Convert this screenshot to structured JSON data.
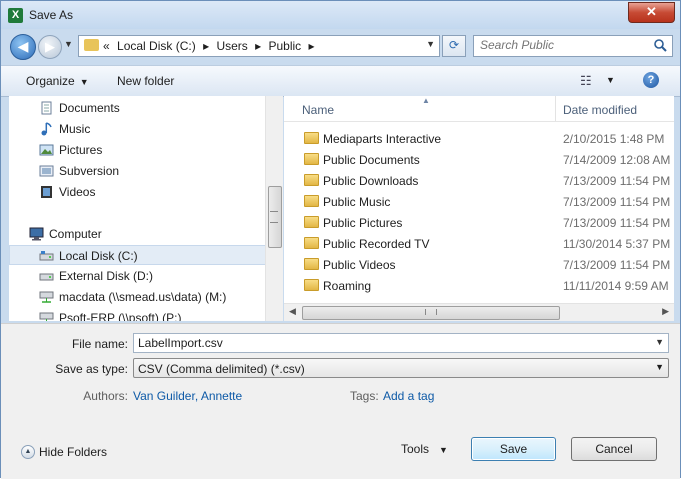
{
  "window": {
    "title": "Save As",
    "close_label": "✕"
  },
  "address": {
    "crumbs": [
      "«",
      "Local Disk (C:)",
      "▸",
      "Users",
      "▸",
      "Public",
      "▸"
    ],
    "search_placeholder": "Search Public"
  },
  "toolbar": {
    "organize_label": "Organize",
    "new_folder_label": "New folder",
    "help_label": "?"
  },
  "nav": {
    "items": [
      {
        "label": "Documents",
        "icon": "documents-icon"
      },
      {
        "label": "Music",
        "icon": "music-icon"
      },
      {
        "label": "Pictures",
        "icon": "pictures-icon"
      },
      {
        "label": "Subversion",
        "icon": "subversion-icon"
      },
      {
        "label": "Videos",
        "icon": "videos-icon"
      },
      {
        "label": "Computer",
        "icon": "computer-icon"
      },
      {
        "label": "Local Disk (C:)",
        "icon": "local-disk-icon",
        "selected": true
      },
      {
        "label": "External Disk (D:)",
        "icon": "external-disk-icon"
      },
      {
        "label": "macdata (\\\\smead.us\\data) (M:)",
        "icon": "network-drive-icon"
      },
      {
        "label": "Psoft-ERP (\\\\psoft) (P:)",
        "icon": "network-drive-icon"
      }
    ]
  },
  "files": {
    "columns": {
      "name": "Name",
      "date": "Date modified"
    },
    "rows": [
      {
        "name": "Mediaparts Interactive",
        "date": "2/10/2015 1:48 PM"
      },
      {
        "name": "Public Documents",
        "date": "7/14/2009 12:08 AM"
      },
      {
        "name": "Public Downloads",
        "date": "7/13/2009 11:54 PM"
      },
      {
        "name": "Public Music",
        "date": "7/13/2009 11:54 PM"
      },
      {
        "name": "Public Pictures",
        "date": "7/13/2009 11:54 PM"
      },
      {
        "name": "Public Recorded TV",
        "date": "11/30/2014 5:37 PM"
      },
      {
        "name": "Public Videos",
        "date": "7/13/2009 11:54 PM"
      },
      {
        "name": "Roaming",
        "date": "11/11/2014 9:59 AM"
      }
    ]
  },
  "form": {
    "file_name_label": "File name:",
    "file_name_value": "LabelImport.csv",
    "save_type_label": "Save as type:",
    "save_type_value": "CSV (Comma delimited) (*.csv)",
    "authors_label": "Authors:",
    "authors_value": "Van Guilder, Annette",
    "tags_label": "Tags:",
    "tags_value": "Add a tag"
  },
  "footer": {
    "hide_folders_label": "Hide Folders",
    "tools_label": "Tools",
    "save_label": "Save",
    "cancel_label": "Cancel"
  }
}
